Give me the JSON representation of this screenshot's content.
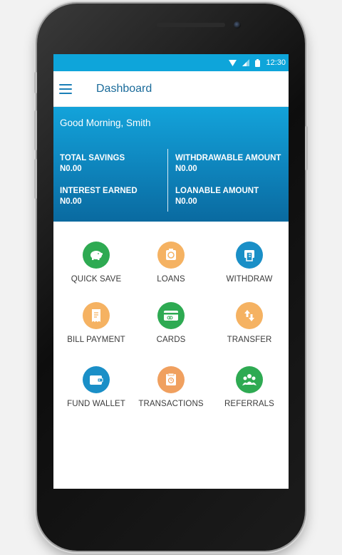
{
  "status_bar": {
    "time": "12:30"
  },
  "app_bar": {
    "title": "Dashboard"
  },
  "hero": {
    "greeting": "Good Morning, Smith",
    "stats": [
      {
        "label": "TOTAL SAVINGS",
        "value": "N0.00"
      },
      {
        "label": "WITHDRAWABLE AMOUNT",
        "value": "N0.00"
      },
      {
        "label": "INTEREST EARNED",
        "value": "N0.00"
      },
      {
        "label": "LOANABLE AMOUNT",
        "value": "N0.00"
      }
    ]
  },
  "menu": [
    {
      "label": "QUICK SAVE",
      "icon": "piggy-bank-icon",
      "color": "#2eaa52"
    },
    {
      "label": "LOANS",
      "icon": "loan-icon",
      "color": "#f5b262"
    },
    {
      "label": "WITHDRAW",
      "icon": "atm-withdraw-icon",
      "color": "#1a8fc7"
    },
    {
      "label": "BILL PAYMENT",
      "icon": "receipt-icon",
      "color": "#f5b262"
    },
    {
      "label": "CARDS",
      "icon": "credit-card-icon",
      "color": "#2eaa52"
    },
    {
      "label": "TRANSFER",
      "icon": "transfer-arrows-icon",
      "color": "#f5b262"
    },
    {
      "label": "FUND WALLET",
      "icon": "wallet-icon",
      "color": "#1a8fc7"
    },
    {
      "label": "TRANSACTIONS",
      "icon": "transactions-icon",
      "color": "#f0a05f"
    },
    {
      "label": "REFERRALS",
      "icon": "people-group-icon",
      "color": "#2eaa52"
    }
  ],
  "colors": {
    "status_bar": "#0ea5da",
    "hero_top": "#13a3da",
    "hero_bottom": "#0a6aa0",
    "title": "#1a6b9a"
  }
}
